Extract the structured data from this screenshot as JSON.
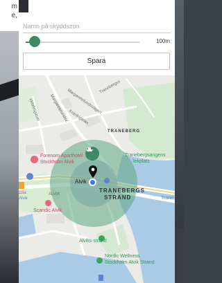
{
  "background": {
    "partial_text": [
      "m",
      "e,"
    ]
  },
  "form": {
    "name_placeholder": "Namn på skyddszon",
    "name_value": "",
    "radius_label": "100m",
    "radius_fraction": 0.08,
    "save_label": "Spara"
  },
  "map": {
    "streets": {
      "margaretelundsv": "Margaretelundsv.",
      "vidalvsgatan": "Vidalvsgatan",
      "margaretelundsvagen": "Margaretelundsvägen",
      "kranfrigatan": "Kranfrigatan",
      "tranebergsv": "Tranebergsv.",
      "alvik_road": "ALVIK"
    },
    "labels": {
      "traneberg": "TRANEBERG",
      "tranebergsangens": "Tranebergsangens",
      "lekplats": "lekplats",
      "forenom_1": "Forenom Aparthotel",
      "forenom_2": "Stockholm Alvik",
      "alvik": "Alvik",
      "scandic": "Scandic Alvik",
      "tranebergs": "TRANEBERGS",
      "strand": "STRAND",
      "orzia": "zzia",
      "alvik_small": "Alvik",
      "alviks_strand": "Alviks strand",
      "nordic_1": "Nordic Wellness",
      "nordic_2": "Stockholm Alvik Strand",
      "trane": "Trane"
    },
    "colors": {
      "zone_fill": "#5fa783",
      "accent": "#3d8b66",
      "water": "#aacbe5",
      "park": "#cfe8c9"
    }
  }
}
